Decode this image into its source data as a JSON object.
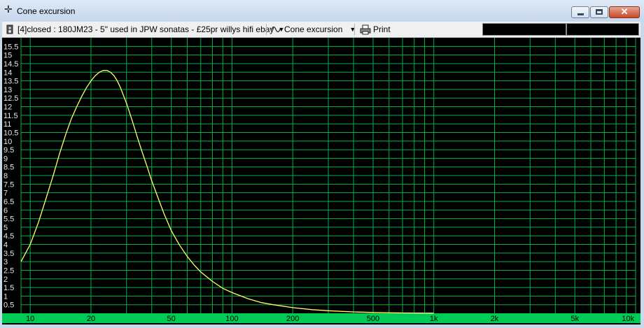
{
  "window": {
    "title": "Cone excursion"
  },
  "toolbar": {
    "project": "[4]closed : 180JM23 - 5\" used in JPW sonatas - £25pr willys hifi ebay",
    "view": "Cone excursion",
    "print": "Print"
  },
  "colors": {
    "background": "#000000",
    "grid": "#00b24a",
    "curve": "#ffff66",
    "axis_band": "#00cc55",
    "tick_text": "#e8e8e8"
  },
  "chart_data": {
    "type": "line",
    "title": "",
    "xlabel": "",
    "ylabel": "",
    "xscale": "log",
    "xlim": [
      9,
      10000
    ],
    "ylim": [
      0,
      16
    ],
    "grid": true,
    "x_tick_labels": [
      "10",
      "20",
      "50",
      "100",
      "200",
      "500",
      "1k",
      "2k",
      "5k",
      "10k"
    ],
    "x_ticks": [
      10,
      20,
      50,
      100,
      200,
      500,
      1000,
      2000,
      5000,
      10000
    ],
    "y_tick_labels": [
      "0.5",
      "1",
      "1.5",
      "2",
      "2.5",
      "3",
      "3.5",
      "4",
      "4.5",
      "5",
      "5.5",
      "6",
      "6.5",
      "7",
      "7.5",
      "8",
      "8.5",
      "9",
      "9.5",
      "10",
      "10.5",
      "11",
      "11.5",
      "12",
      "12.5",
      "13",
      "13.5",
      "14",
      "14.5",
      "15",
      "15.5"
    ],
    "y_ticks": [
      0.5,
      1,
      1.5,
      2,
      2.5,
      3,
      3.5,
      4,
      4.5,
      5,
      5.5,
      6,
      6.5,
      7,
      7.5,
      8,
      8.5,
      9,
      9.5,
      10,
      10.5,
      11,
      11.5,
      12,
      12.5,
      13,
      13.5,
      14,
      14.5,
      15,
      15.5
    ],
    "series": [
      {
        "x": [
          9,
          10,
          11,
          12,
          13,
          14,
          15,
          16,
          17,
          18,
          19,
          20,
          21,
          22,
          23,
          24,
          25,
          26,
          27,
          28,
          30,
          32,
          34,
          36,
          38,
          40,
          43,
          46,
          50,
          55,
          60,
          65,
          70,
          80,
          90,
          100,
          120,
          140,
          160,
          200,
          250,
          300,
          400,
          500,
          700,
          1000
        ],
        "y": [
          3.0,
          4.0,
          5.3,
          6.7,
          8.0,
          9.3,
          10.4,
          11.3,
          12.0,
          12.6,
          13.1,
          13.5,
          13.8,
          14.0,
          14.1,
          14.1,
          14.0,
          13.8,
          13.5,
          13.1,
          12.2,
          11.2,
          10.2,
          9.3,
          8.5,
          7.7,
          6.7,
          5.8,
          4.8,
          3.95,
          3.3,
          2.8,
          2.4,
          1.85,
          1.45,
          1.2,
          0.85,
          0.62,
          0.5,
          0.33,
          0.21,
          0.15,
          0.08,
          0.05,
          0.02,
          0.01
        ]
      }
    ]
  }
}
